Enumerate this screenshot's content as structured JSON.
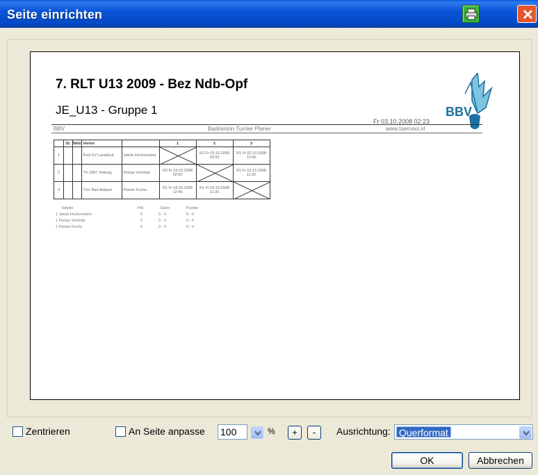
{
  "window": {
    "title": "Seite einrichten",
    "print_icon": "printer-icon",
    "close_icon": "close-icon",
    "close_symbol": "✕"
  },
  "preview": {
    "title": "7. RLT U13 2009 - Bez Ndb-Opf",
    "subtitle": "JE_U13 - Gruppe 1",
    "date": "Fr 03.10.2008 02:23",
    "left_header": "BBV",
    "center_header": "Badminton Turnier Planer",
    "right_header": "www.toernooi.nl",
    "table": {
      "headers": [
        "St.",
        "Web",
        "Verein",
        "",
        "1",
        "2",
        "3"
      ],
      "rows": [
        {
          "num": "1",
          "club": "Post SV Landshut",
          "player": "Jakob Fleckenstein",
          "c1": "",
          "c2": "R2 Fr 03.10.2008 02:00",
          "c3": "R1 Fr 03.10.2008 12:40"
        },
        {
          "num": "2",
          "club": "TV 1897 Velburg",
          "player": "Florian Schimpl",
          "c1": "R2 Fr 03.10.2008 02:00",
          "c2": "",
          "c3": "R1 Fr 03.10.2008 11:20"
        },
        {
          "num": "3",
          "club": "TSV Bad Abbach",
          "player": "Florian Fuchs",
          "c1": "R1 Fr 03.10.2008 12:40",
          "c2": "R1 Fr 03.10.2008 11:20",
          "c3": ""
        }
      ]
    },
    "standings": {
      "headers": [
        "Tabelle",
        "Pkt.",
        "Sätze",
        "Punkte"
      ],
      "rows": [
        {
          "name": "1 Jakob Fleckenstein",
          "pkt": "0",
          "saetze": "0 - 0",
          "punkte": "0 - 0"
        },
        {
          "name": "1 Florian Schimpl",
          "pkt": "0",
          "saetze": "0 - 0",
          "punkte": "0 - 0"
        },
        {
          "name": "1 Florian Fuchs",
          "pkt": "0",
          "saetze": "0 - 0",
          "punkte": "0 - 0"
        }
      ]
    }
  },
  "controls": {
    "center_label": "Zentrieren",
    "fit_label": "An Seite anpasse",
    "zoom_value": "100",
    "percent": "%",
    "plus": "+",
    "minus": "-",
    "orientation_label": "Ausrichtung:",
    "orientation_value": "Querformat",
    "ok": "OK",
    "cancel": "Abbrechen"
  },
  "colors": {
    "titlebar": "#0449c6",
    "selection": "#316ac5",
    "print_button": "#3bb23b",
    "close_button": "#e4572e"
  }
}
